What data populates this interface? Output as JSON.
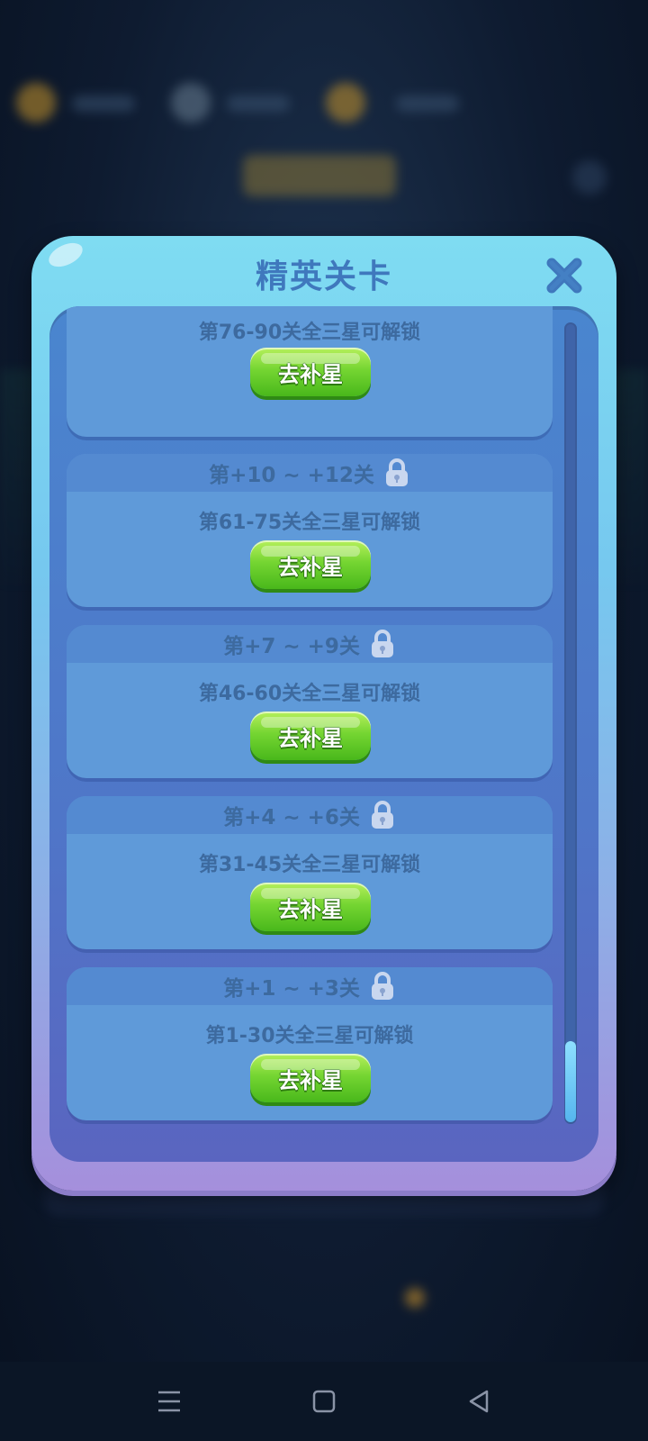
{
  "modal": {
    "title": "精英关卡",
    "close_icon": "close-x-icon"
  },
  "cards": [
    {
      "range": "",
      "requirement": "第76-90关全三星可解锁",
      "button": "去补星",
      "locked": false
    },
    {
      "range": "第+10 ~ +12关",
      "requirement": "第61-75关全三星可解锁",
      "button": "去补星",
      "locked": true
    },
    {
      "range": "第+7 ~ +9关",
      "requirement": "第46-60关全三星可解锁",
      "button": "去补星",
      "locked": true
    },
    {
      "range": "第+4 ~ +6关",
      "requirement": "第31-45关全三星可解锁",
      "button": "去补星",
      "locked": true
    },
    {
      "range": "第+1 ~ +3关",
      "requirement": "第1-30关全三星可解锁",
      "button": "去补星",
      "locked": true
    }
  ],
  "scroll": {
    "position": 1.0
  },
  "colors": {
    "accent": "#3f78bd",
    "button_green": "#58c423",
    "panel": "#5f9ad9"
  },
  "navbar": {
    "icons": [
      "menu-icon",
      "home-square-icon",
      "back-triangle-icon"
    ]
  }
}
